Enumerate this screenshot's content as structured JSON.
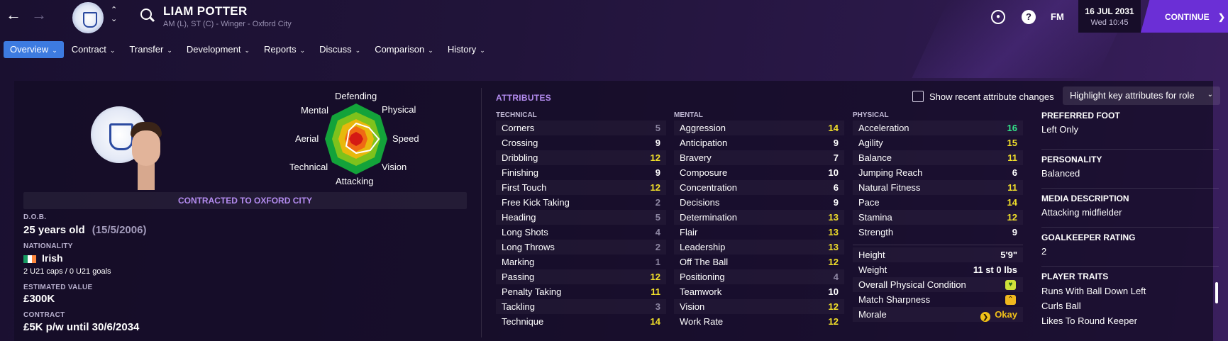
{
  "header": {
    "player_name": "LIAM POTTER",
    "player_sub": "AM (L), ST (C) - Winger - Oxford City",
    "fm_label": "FM",
    "date_main": "16 JUL 2031",
    "date_sub": "Wed 10:45",
    "continue_label": "CONTINUE"
  },
  "tabs": [
    {
      "label": "Overview",
      "active": true
    },
    {
      "label": "Contract"
    },
    {
      "label": "Transfer"
    },
    {
      "label": "Development"
    },
    {
      "label": "Reports"
    },
    {
      "label": "Discuss"
    },
    {
      "label": "Comparison"
    },
    {
      "label": "History"
    }
  ],
  "radar": {
    "labels": {
      "defending": "Defending",
      "physical": "Physical",
      "speed": "Speed",
      "vision": "Vision",
      "attacking": "Attacking",
      "technical": "Technical",
      "aerial": "Aerial",
      "mental": "Mental"
    }
  },
  "profile": {
    "contract_banner": "CONTRACTED TO OXFORD CITY",
    "dob_label": "D.O.B.",
    "dob_value": "25 years old",
    "dob_date": "(15/5/2006)",
    "nationality_label": "NATIONALITY",
    "nationality_value": "Irish",
    "caps": "2 U21 caps / 0 U21 goals",
    "value_label": "ESTIMATED VALUE",
    "value_value": "£300K",
    "contract_label": "CONTRACT",
    "contract_value": "£5K p/w until 30/6/2034"
  },
  "attributes": {
    "title": "ATTRIBUTES",
    "show_recent_label": "Show recent attribute changes",
    "highlight_label": "Highlight key attributes for role",
    "technical_head": "TECHNICAL",
    "mental_head": "MENTAL",
    "physical_head": "PHYSICAL",
    "technical": [
      {
        "name": "Corners",
        "value": "5",
        "tier": "grey"
      },
      {
        "name": "Crossing",
        "value": "9",
        "tier": "white"
      },
      {
        "name": "Dribbling",
        "value": "12",
        "tier": "yellow"
      },
      {
        "name": "Finishing",
        "value": "9",
        "tier": "white"
      },
      {
        "name": "First Touch",
        "value": "12",
        "tier": "yellow"
      },
      {
        "name": "Free Kick Taking",
        "value": "2",
        "tier": "grey"
      },
      {
        "name": "Heading",
        "value": "5",
        "tier": "grey"
      },
      {
        "name": "Long Shots",
        "value": "4",
        "tier": "grey"
      },
      {
        "name": "Long Throws",
        "value": "2",
        "tier": "grey"
      },
      {
        "name": "Marking",
        "value": "1",
        "tier": "grey"
      },
      {
        "name": "Passing",
        "value": "12",
        "tier": "yellow"
      },
      {
        "name": "Penalty Taking",
        "value": "11",
        "tier": "yellow"
      },
      {
        "name": "Tackling",
        "value": "3",
        "tier": "grey"
      },
      {
        "name": "Technique",
        "value": "14",
        "tier": "yellow"
      }
    ],
    "mental": [
      {
        "name": "Aggression",
        "value": "14",
        "tier": "yellow"
      },
      {
        "name": "Anticipation",
        "value": "9",
        "tier": "white"
      },
      {
        "name": "Bravery",
        "value": "7",
        "tier": "white"
      },
      {
        "name": "Composure",
        "value": "10",
        "tier": "white"
      },
      {
        "name": "Concentration",
        "value": "6",
        "tier": "white"
      },
      {
        "name": "Decisions",
        "value": "9",
        "tier": "white"
      },
      {
        "name": "Determination",
        "value": "13",
        "tier": "yellow"
      },
      {
        "name": "Flair",
        "value": "13",
        "tier": "yellow"
      },
      {
        "name": "Leadership",
        "value": "13",
        "tier": "yellow"
      },
      {
        "name": "Off The Ball",
        "value": "12",
        "tier": "yellow"
      },
      {
        "name": "Positioning",
        "value": "4",
        "tier": "grey"
      },
      {
        "name": "Teamwork",
        "value": "10",
        "tier": "white"
      },
      {
        "name": "Vision",
        "value": "12",
        "tier": "yellow"
      },
      {
        "name": "Work Rate",
        "value": "12",
        "tier": "yellow"
      }
    ],
    "physical": [
      {
        "name": "Acceleration",
        "value": "16",
        "tier": "green"
      },
      {
        "name": "Agility",
        "value": "15",
        "tier": "yellow"
      },
      {
        "name": "Balance",
        "value": "11",
        "tier": "yellow"
      },
      {
        "name": "Jumping Reach",
        "value": "6",
        "tier": "white"
      },
      {
        "name": "Natural Fitness",
        "value": "11",
        "tier": "yellow"
      },
      {
        "name": "Pace",
        "value": "14",
        "tier": "yellow"
      },
      {
        "name": "Stamina",
        "value": "12",
        "tier": "yellow"
      },
      {
        "name": "Strength",
        "value": "9",
        "tier": "white"
      }
    ],
    "physical_extra": {
      "height_label": "Height",
      "height_value": "5'9\"",
      "weight_label": "Weight",
      "weight_value": "11 st 0 lbs",
      "condition_label": "Overall Physical Condition",
      "sharpness_label": "Match Sharpness",
      "morale_label": "Morale",
      "morale_value": "Okay"
    }
  },
  "side_info": {
    "foot_label": "PREFERRED FOOT",
    "foot_value": "Left Only",
    "personality_label": "PERSONALITY",
    "personality_value": "Balanced",
    "media_label": "MEDIA DESCRIPTION",
    "media_value": "Attacking midfielder",
    "gk_label": "GOALKEEPER RATING",
    "gk_value": "2",
    "traits_label": "PLAYER TRAITS",
    "traits": [
      "Runs With Ball Down Left",
      "Curls Ball",
      "Likes To Round Keeper"
    ]
  },
  "colors": {
    "accent": "#6b2fd6",
    "tab_active": "#3d7be0",
    "highlight": "#b48cf0",
    "good": "#f2e02a",
    "excellent": "#33e58a"
  },
  "icons": [
    "back-arrow-icon",
    "forward-arrow-icon",
    "club-badge-icon",
    "search-icon",
    "globe-icon",
    "help-icon",
    "heart-icon",
    "sharpness-icon",
    "morale-icon"
  ]
}
